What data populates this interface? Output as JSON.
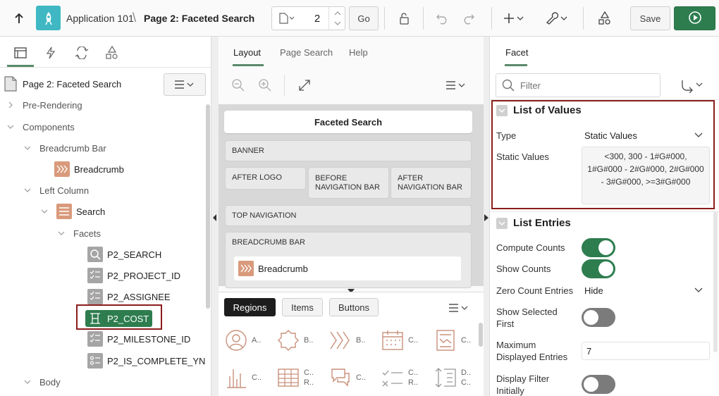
{
  "header": {
    "app_name": "Application 101",
    "breadcrumb_separator": "\\",
    "page_title": "Page 2: Faceted Search",
    "page_number": "2",
    "go_label": "Go",
    "save_label": "Save",
    "icons": [
      "up-arrow-icon",
      "app-rocket-icon",
      "page-icon",
      "lock-icon",
      "undo-icon",
      "redo-icon",
      "plus-icon",
      "wrench-icon",
      "shared-components-icon",
      "run-icon"
    ]
  },
  "left": {
    "root_label": "Page 2: Faceted Search",
    "tree": {
      "pre_rendering": "Pre-Rendering",
      "components": "Components",
      "breadcrumb_bar": "Breadcrumb Bar",
      "breadcrumb": "Breadcrumb",
      "left_column": "Left Column",
      "search": "Search",
      "facets": "Facets",
      "p2_search": "P2_SEARCH",
      "p2_project_id": "P2_PROJECT_ID",
      "p2_assignee": "P2_ASSIGNEE",
      "p2_cost": "P2_COST",
      "p2_milestone_id": "P2_MILESTONE_ID",
      "p2_is_complete_yn": "P2_IS_COMPLETE_YN",
      "body": "Body"
    }
  },
  "middle": {
    "tabs": {
      "layout": "Layout",
      "page_search": "Page Search",
      "help": "Help"
    },
    "canvas": {
      "faceted_search": "Faceted Search",
      "banner": "BANNER",
      "after_logo": "AFTER LOGO",
      "before_nav": "BEFORE NAVIGATION BAR",
      "after_nav": "AFTER NAVIGATION BAR",
      "top_nav": "TOP NAVIGATION",
      "breadcrumb_bar": "BREADCRUMB BAR",
      "breadcrumb_item": "Breadcrumb"
    },
    "gallery": {
      "tabs": {
        "regions": "Regions",
        "items": "Items",
        "buttons": "Buttons"
      },
      "items": [
        {
          "label": "A..",
          "icon": "avatar-icon"
        },
        {
          "label": "B..",
          "icon": "badge-icon"
        },
        {
          "label": "B..",
          "icon": "breadcrumb-icon"
        },
        {
          "label": "C..",
          "icon": "calendar-icon"
        },
        {
          "label": "C..",
          "icon": "card-chart-icon"
        },
        {
          "label": "C..",
          "icon": "bar-chart-icon"
        },
        {
          "label": "C.. R..",
          "icon": "table-icon"
        },
        {
          "label": "C..",
          "icon": "comments-icon"
        },
        {
          "label": "C.. R..",
          "icon": "checklist-icon"
        },
        {
          "label": "D.. C..",
          "icon": "dynamic-content-icon"
        }
      ]
    }
  },
  "right": {
    "tab": "Facet",
    "filter_placeholder": "Filter",
    "list_of_values": {
      "title": "List of Values",
      "type_label": "Type",
      "type_value": "Static Values",
      "static_label": "Static Values",
      "static_value": "<300, 300 - 1#G#000, 1#G#000 - 2#G#000, 2#G#000 - 3#G#000, >=3#G#000"
    },
    "list_entries": {
      "title": "List Entries",
      "compute_counts": "Compute Counts",
      "compute_counts_on": true,
      "show_counts": "Show Counts",
      "show_counts_on": true,
      "zero_count": "Zero Count Entries",
      "zero_count_value": "Hide",
      "show_selected_first": "Show Selected First",
      "show_selected_first_on": false,
      "max_displayed": "Maximum Displayed Entries",
      "max_displayed_value": "7",
      "display_filter": "Display Filter Initially",
      "display_filter_on": false
    }
  },
  "colors": {
    "accent_green": "#2e7d4f",
    "app_teal": "#3fb8c4",
    "highlight_red": "#8c1c1c",
    "region_orange": "#d99a7c"
  }
}
